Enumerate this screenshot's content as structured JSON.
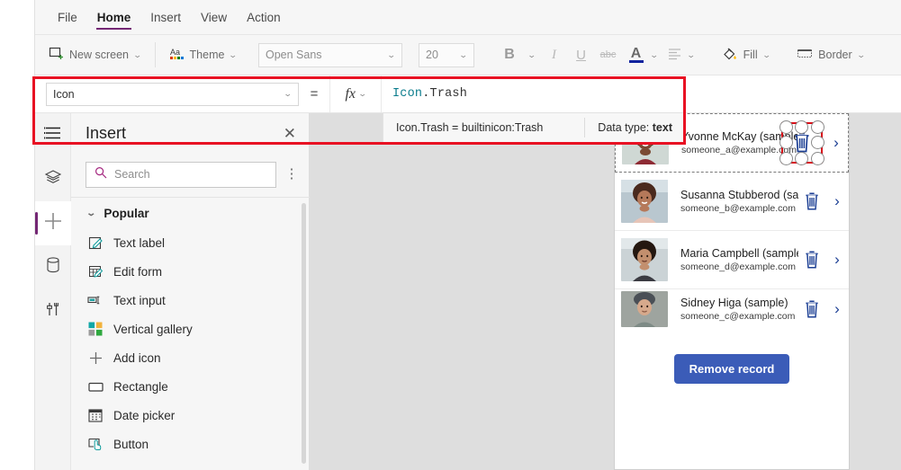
{
  "menubar": {
    "items": [
      {
        "label": "File",
        "active": false
      },
      {
        "label": "Home",
        "active": true
      },
      {
        "label": "Insert",
        "active": false
      },
      {
        "label": "View",
        "active": false
      },
      {
        "label": "Action",
        "active": false
      }
    ]
  },
  "ribbon": {
    "new_screen": "New screen",
    "theme": "Theme",
    "font_family": "Open Sans",
    "font_size": "20",
    "bold": "B",
    "italic": "I",
    "underline": "U",
    "strikethrough": "abc",
    "font_color": "A",
    "align": "align-icon",
    "fill": "Fill",
    "border": "Border"
  },
  "formula_bar": {
    "property": "Icon",
    "equals": "=",
    "fx": "fx",
    "formula_namespace": "Icon",
    "formula_dot": ".",
    "formula_member": "Trash",
    "tooltip_signature": "Icon.Trash  =  builtinicon:Trash",
    "tooltip_datatype_label": "Data type:",
    "tooltip_datatype_value": "text"
  },
  "rail": {
    "items": [
      {
        "name": "menu-icon",
        "label": "Menu"
      },
      {
        "name": "tree-view-icon",
        "label": "Tree view"
      },
      {
        "name": "insert-icon",
        "label": "Insert",
        "selected": true
      },
      {
        "name": "data-icon",
        "label": "Data"
      },
      {
        "name": "tools-icon",
        "label": "Advanced tools"
      }
    ]
  },
  "panel": {
    "title": "Insert",
    "close": "✕",
    "search_placeholder": "Search",
    "kebab": "⋮",
    "group_label": "Popular",
    "items": [
      {
        "label": "Text label",
        "icon": "text-label-icon"
      },
      {
        "label": "Edit form",
        "icon": "edit-form-icon"
      },
      {
        "label": "Text input",
        "icon": "text-input-icon"
      },
      {
        "label": "Vertical gallery",
        "icon": "vertical-gallery-icon"
      },
      {
        "label": "Add icon",
        "icon": "add-icon"
      },
      {
        "label": "Rectangle",
        "icon": "rectangle-icon"
      },
      {
        "label": "Date picker",
        "icon": "date-picker-icon"
      },
      {
        "label": "Button",
        "icon": "button-icon"
      }
    ]
  },
  "canvas": {
    "gallery": [
      {
        "name": "Yvonne McKay (sample)",
        "email": "someone_a@example.com",
        "selected": true
      },
      {
        "name": "Susanna Stubberod (sample)",
        "email": "someone_b@example.com",
        "selected": false
      },
      {
        "name": "Maria Campbell (sample)",
        "email": "someone_d@example.com",
        "selected": false
      },
      {
        "name": "Sidney Higa (sample)",
        "email": "someone_c@example.com",
        "selected": false
      }
    ],
    "remove_button": "Remove record"
  },
  "colors": {
    "accent_purple": "#742774",
    "annotation_red": "#e81123",
    "trash_blue": "#1c3f94",
    "button_blue": "#3b5cb8",
    "canvas_gray": "#dedede"
  }
}
